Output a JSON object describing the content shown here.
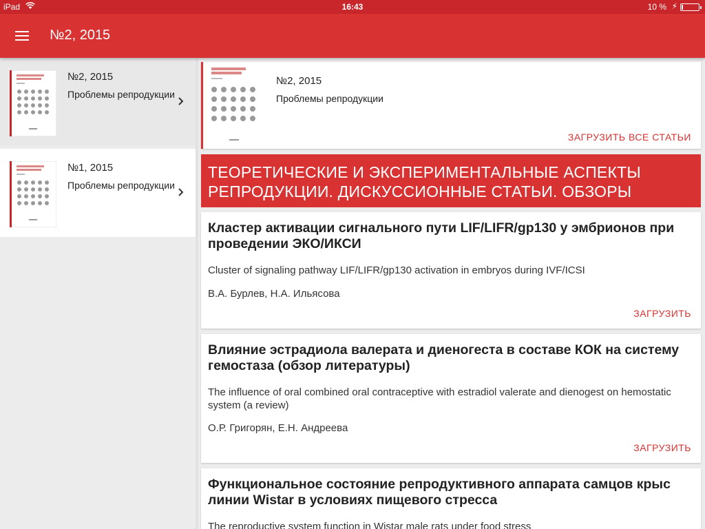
{
  "status_bar": {
    "device": "iPad",
    "time": "16:43",
    "battery_percent": "10 %",
    "battery_level": 0.1
  },
  "toolbar": {
    "title": "№2, 2015"
  },
  "sidebar": {
    "items": [
      {
        "number": "№2, 2015",
        "journal": "Проблемы репродукции",
        "selected": true
      },
      {
        "number": "№1, 2015",
        "journal": "Проблемы репродукции",
        "selected": false
      }
    ]
  },
  "issue_card": {
    "number": "№2, 2015",
    "journal": "Проблемы репродукции",
    "load_all_label": "ЗАГРУЗИТЬ ВСЕ СТАТЬИ"
  },
  "section": {
    "title": "ТЕОРЕТИЧЕСКИЕ И ЭКСПЕРИМЕНТАЛЬНЫЕ АСПЕКТЫ РЕПРОДУКЦИИ. ДИСКУССИОННЫЕ СТАТЬИ. ОБЗОРЫ"
  },
  "articles": [
    {
      "title": "Кластер активации сигнального пути LIF/LIFR/gp130 у эмбрионов при проведении ЭКО/ИКСИ",
      "english": "Cluster of signaling pathway LIF/LIFR/gp130 activation in embryos during IVF/ICSI",
      "authors": "В.А. Бурлев, Н.А. Ильясова",
      "load_label": "ЗАГРУЗИТЬ"
    },
    {
      "title": "Влияние эстрадиола валерата и диеногеста в составе КОК на систему гемостаза (обзор литературы)",
      "english": "The influence of oral combined oral contraceptive with estradiol valerate and dienogest  on hemostatic system (a review)",
      "authors": "О.Р. Григорян, Е.Н. Андреева",
      "load_label": "ЗАГРУЗИТЬ"
    },
    {
      "title": "Функциональное состояние репродуктивного аппарата самцов крыс линии Wistar в условиях пищевого стресса",
      "english": "The reproductive system function in Wistar male rats under food stress"
    }
  ],
  "colors": {
    "status_bar": "#c8262a",
    "toolbar": "#d83232",
    "accent": "#d83232",
    "background": "#ececec",
    "card": "#ffffff"
  },
  "icons": {
    "menu": "hamburger-icon",
    "chevron": "chevron-right-icon",
    "wifi": "wifi-icon",
    "battery": "battery-icon",
    "charging": "charging-icon"
  }
}
